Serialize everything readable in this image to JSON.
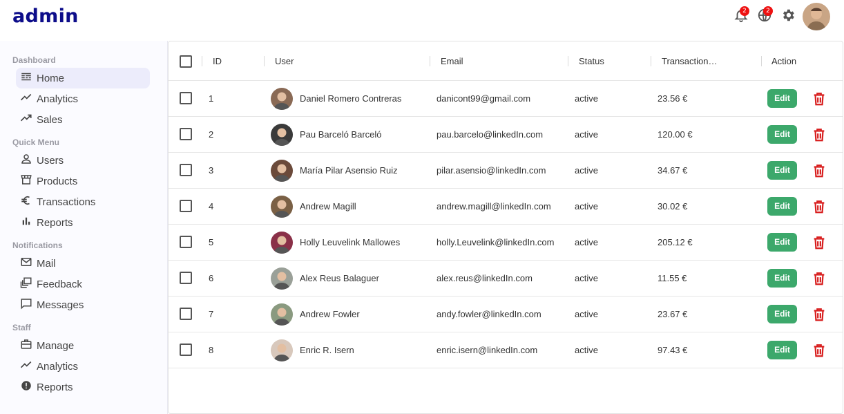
{
  "app": {
    "logo": "admin"
  },
  "topbar": {
    "notifications": {
      "icon": "bell-icon",
      "count": "2"
    },
    "language": {
      "icon": "globe-icon",
      "count": "2"
    },
    "settings": {
      "icon": "gear-icon"
    },
    "avatar": {
      "icon": "user-avatar"
    }
  },
  "sidebar": {
    "sections": [
      {
        "title": "Dashboard",
        "items": [
          {
            "label": "Home",
            "icon": "dashboard-icon",
            "active": true
          },
          {
            "label": "Analytics",
            "icon": "trending-up-icon"
          },
          {
            "label": "Sales",
            "icon": "trending-up-icon"
          }
        ]
      },
      {
        "title": "Quick Menu",
        "items": [
          {
            "label": "Users",
            "icon": "user-icon"
          },
          {
            "label": "Products",
            "icon": "storefront-icon"
          },
          {
            "label": "Transactions",
            "icon": "euro-icon"
          },
          {
            "label": "Reports",
            "icon": "bar-chart-icon"
          }
        ]
      },
      {
        "title": "Notifications",
        "items": [
          {
            "label": "Mail",
            "icon": "mail-icon"
          },
          {
            "label": "Feedback",
            "icon": "feedback-icon"
          },
          {
            "label": "Messages",
            "icon": "chat-icon"
          }
        ]
      },
      {
        "title": "Staff",
        "items": [
          {
            "label": "Manage",
            "icon": "briefcase-icon"
          },
          {
            "label": "Analytics",
            "icon": "trending-up-icon"
          },
          {
            "label": "Reports",
            "icon": "alert-icon"
          }
        ]
      }
    ]
  },
  "table": {
    "headers": {
      "id": "ID",
      "user": "User",
      "email": "Email",
      "status": "Status",
      "transaction": "Transaction…",
      "action": "Action"
    },
    "edit_label": "Edit",
    "rows": [
      {
        "id": "1",
        "user": "Daniel Romero Contreras",
        "email": "danicont99@gmail.com",
        "status": "active",
        "transaction": "23.56 €",
        "avatar_color": "#8a6a55"
      },
      {
        "id": "2",
        "user": "Pau Barceló Barceló",
        "email": "pau.barcelo@linkedIn.com",
        "status": "active",
        "transaction": "120.00 €",
        "avatar_color": "#3a3a3a"
      },
      {
        "id": "3",
        "user": "María Pilar Asensio Ruiz",
        "email": "pilar.asensio@linkedIn.com",
        "status": "active",
        "transaction": "34.67 €",
        "avatar_color": "#6b4a3a"
      },
      {
        "id": "4",
        "user": "Andrew Magill",
        "email": "andrew.magill@linkedIn.com",
        "status": "active",
        "transaction": "30.02 €",
        "avatar_color": "#7a6045"
      },
      {
        "id": "5",
        "user": "Holly Leuvelink Mallowes",
        "email": "holly.Leuvelink@linkedIn.com",
        "status": "active",
        "transaction": "205.12 €",
        "avatar_color": "#8a3048"
      },
      {
        "id": "6",
        "user": "Alex Reus Balaguer",
        "email": "alex.reus@linkedIn.com",
        "status": "active",
        "transaction": "11.55 €",
        "avatar_color": "#9aa098"
      },
      {
        "id": "7",
        "user": "Andrew Fowler",
        "email": "andy.fowler@linkedIn.com",
        "status": "active",
        "transaction": "23.67 €",
        "avatar_color": "#8a9a80"
      },
      {
        "id": "8",
        "user": "Enric R. Isern",
        "email": "enric.isern@linkedIn.com",
        "status": "active",
        "transaction": "97.43 €",
        "avatar_color": "#d8c8bc"
      }
    ]
  },
  "colors": {
    "brand": "#0d0d8a",
    "edit": "#3ca86b",
    "delete": "#d81e1e",
    "badge": "#ee1111"
  }
}
